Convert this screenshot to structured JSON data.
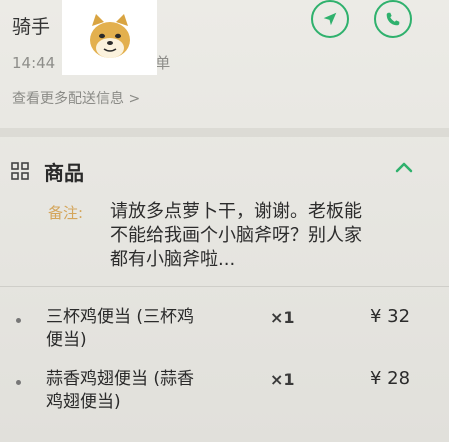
{
  "rider": {
    "title": "骑手",
    "subtitle": "14:44",
    "subtitle_tail": "单",
    "more_info": "查看更多配送信息 >"
  },
  "icons": {
    "navigate": "navigation-arrow-icon",
    "phone": "phone-icon",
    "overlay": "doge-sticker-icon",
    "goods": "grid-icon",
    "collapse": "chevron-up-icon"
  },
  "colors": {
    "accent": "#2fb16d",
    "note_label": "#d4a55a"
  },
  "goods": {
    "title": "商品",
    "note_label": "备注:",
    "note_lines": [
      "请放多点萝卜干，谢谢。老板能",
      "不能给我画个小脑斧呀？别人家",
      "都有小脑斧啦..."
    ],
    "items": [
      {
        "name_line1": "三杯鸡便当 (三杯鸡",
        "name_line2": "便当)",
        "qty": "×1",
        "price": "¥ 32"
      },
      {
        "name_line1": "蒜香鸡翅便当 (蒜香",
        "name_line2": "鸡翅便当)",
        "qty": "×1",
        "price": "¥ 28"
      }
    ]
  }
}
